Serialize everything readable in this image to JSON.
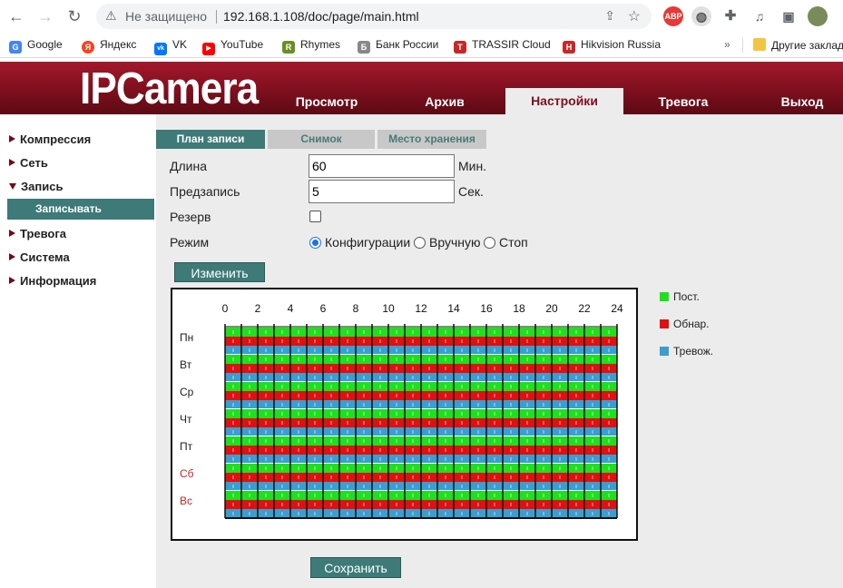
{
  "browser": {
    "insecure_label": "Не защищено",
    "url": "192.168.1.108/doc/page/main.html",
    "extension_abp": "ABP",
    "bookmarks": [
      {
        "label": "Google",
        "color": "#4285f4",
        "icon": "G"
      },
      {
        "label": "Яндекс",
        "color": "#fc3f1d",
        "icon": "Я"
      },
      {
        "label": "VK",
        "color": "#0077ff",
        "icon": "vk"
      },
      {
        "label": "YouTube",
        "color": "#ff0000",
        "icon": "▶"
      },
      {
        "label": "Rhymes",
        "color": "#6b8e23",
        "icon": "R"
      },
      {
        "label": "Банк России",
        "color": "#888888",
        "icon": "Б"
      },
      {
        "label": "TRASSIR Cloud",
        "color": "#c62828",
        "icon": "T"
      },
      {
        "label": "Hikvision Russia",
        "color": "#c62828",
        "icon": "H"
      }
    ],
    "more_bookmarks": "»",
    "other_bookmarks": "Другие заклад"
  },
  "app": {
    "logo": "IPCamera",
    "nav": [
      {
        "label": "Просмотр"
      },
      {
        "label": "Архив"
      },
      {
        "label": "Настройки"
      },
      {
        "label": "Тревога"
      },
      {
        "label": "Выход"
      }
    ],
    "active_nav": "Настройки"
  },
  "sidebar": {
    "items": [
      {
        "label": "Компрессия",
        "expanded": false
      },
      {
        "label": "Сеть",
        "expanded": false
      },
      {
        "label": "Запись",
        "expanded": true
      },
      {
        "label": "Тревога",
        "expanded": false
      },
      {
        "label": "Система",
        "expanded": false
      },
      {
        "label": "Информация",
        "expanded": false
      }
    ],
    "sub_item": "Записывать"
  },
  "tabs": [
    {
      "label": "План записи",
      "active": true
    },
    {
      "label": "Снимок",
      "active": false
    },
    {
      "label": "Место хранения",
      "active": false
    }
  ],
  "form": {
    "length_label": "Длина",
    "length_value": "60",
    "length_unit": "Мин.",
    "prerecord_label": "Предзапись",
    "prerecord_value": "5",
    "prerecord_unit": "Сек.",
    "reserve_label": "Резерв",
    "reserve_checked": false,
    "mode_label": "Режим",
    "mode_options": [
      "Конфигурации",
      "Вручную",
      "Стоп"
    ],
    "mode_selected": "Конфигурации",
    "edit_button": "Изменить",
    "save_button": "Сохранить"
  },
  "schedule": {
    "hour_labels": [
      "0",
      "2",
      "4",
      "6",
      "8",
      "10",
      "12",
      "14",
      "16",
      "18",
      "20",
      "22",
      "24"
    ],
    "days": [
      {
        "label": "Пн",
        "weekend": false
      },
      {
        "label": "Вт",
        "weekend": false
      },
      {
        "label": "Ср",
        "weekend": false
      },
      {
        "label": "Чт",
        "weekend": false
      },
      {
        "label": "Пт",
        "weekend": false
      },
      {
        "label": "Сб",
        "weekend": true
      },
      {
        "label": "Вс",
        "weekend": true
      }
    ],
    "hours": 24,
    "record_types": [
      {
        "label": "Пост.",
        "color": "#1ee01e"
      },
      {
        "label": "Обнар.",
        "color": "#e01010"
      },
      {
        "label": "Тревож.",
        "color": "#3a9ed0"
      }
    ],
    "weekday_label_color": "#222222",
    "weekend_label_color": "#c62828"
  },
  "colors": {
    "accent_teal": "#3d7a78",
    "header_red": "#7e0f1e"
  }
}
